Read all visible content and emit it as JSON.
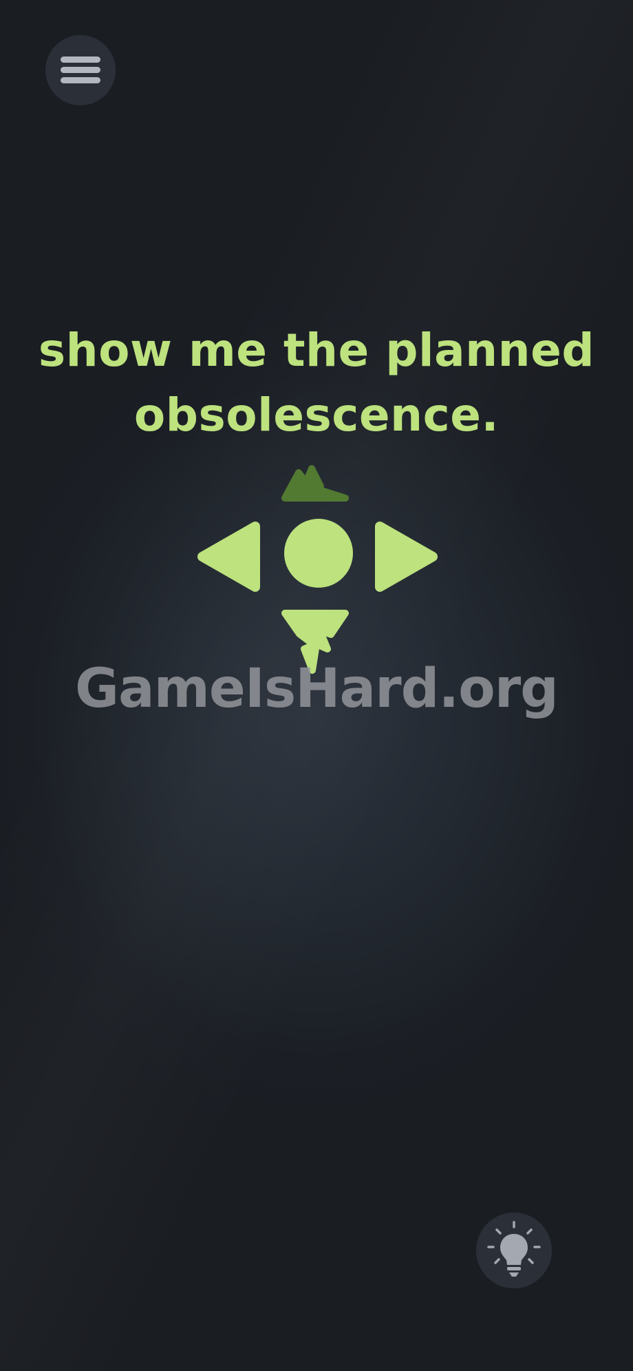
{
  "game": {
    "prompt": "show me the planned obsolescence.",
    "watermark": "GameIsHard.org"
  },
  "menu_button": {
    "icon": "hamburger-menu-icon"
  },
  "hint_button": {
    "icon": "lightbulb-icon"
  },
  "controls": {
    "up": {
      "icon": "broken-triangle-up-icon",
      "state": "dimmed",
      "color": "#537a31"
    },
    "left": {
      "icon": "triangle-left-icon",
      "state": "active",
      "color": "#bde27e"
    },
    "center": {
      "icon": "circle-icon",
      "state": "active",
      "color": "#bde27e"
    },
    "right": {
      "icon": "triangle-right-icon",
      "state": "active",
      "color": "#bde27e"
    },
    "down": {
      "icon": "broken-triangle-down-icon",
      "state": "active",
      "color": "#bde27e"
    }
  },
  "colors": {
    "accent": "#bde27e",
    "accent_dim": "#537a31",
    "background": "#1c2026",
    "button_bg": "#2b3038",
    "icon_gray": "#b3b7bf"
  }
}
